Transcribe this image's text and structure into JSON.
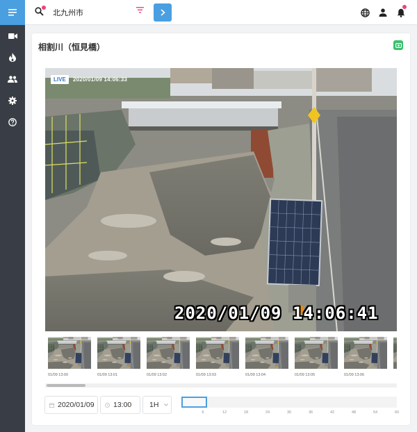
{
  "search": {
    "value": "北九州市",
    "placeholder": ""
  },
  "page": {
    "title": "相割川（恒見橋）"
  },
  "live": {
    "badge": "LIVE",
    "timestamp": "2020/01/09 14:06:33",
    "osd_text": "2020/01/09 14:06:41"
  },
  "thumbnails": [
    {
      "label": "01/09 13:00"
    },
    {
      "label": "01/09 13:01"
    },
    {
      "label": "01/09 13:02"
    },
    {
      "label": "01/09 13:03"
    },
    {
      "label": "01/09 13:04"
    },
    {
      "label": "01/09 13:05"
    },
    {
      "label": "01/09 13:06"
    }
  ],
  "controls": {
    "date": "2020/01/09",
    "time": "13:00",
    "range": "1H"
  },
  "timeline": {
    "ticks": [
      "6",
      "12",
      "18",
      "24",
      "30",
      "36",
      "42",
      "48",
      "54",
      "60"
    ]
  },
  "icons": {
    "rail": [
      "menu-icon",
      "video-camera-icon",
      "fire-icon",
      "people-icon",
      "gear-icon",
      "help-icon"
    ],
    "top": [
      "search-icon",
      "filter-icon",
      "chevron-right-icon",
      "globe-icon",
      "person-icon",
      "bell-icon"
    ],
    "card": [
      "screenshot-icon"
    ]
  },
  "colors": {
    "accent": "#4a9fe0",
    "rail_bg": "#393e46",
    "notification": "#e8457d",
    "snapshot": "#3dbf6e"
  }
}
